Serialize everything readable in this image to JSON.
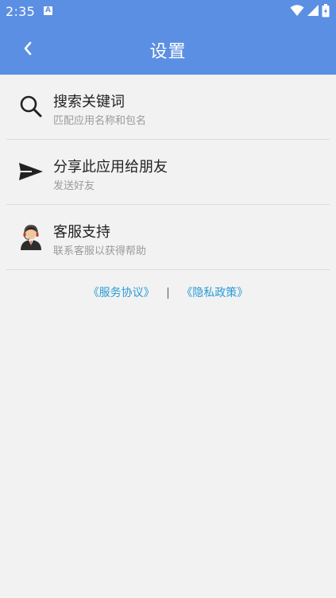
{
  "status_bar": {
    "time": "2:35",
    "notification_glyph": "A",
    "icons": [
      "wifi-icon",
      "signal-icon",
      "battery-icon"
    ]
  },
  "app_bar": {
    "title": "设置",
    "back_icon": "chevron-left-icon",
    "background_color": "#5b8fe3"
  },
  "menu": {
    "items": [
      {
        "icon": "search-icon",
        "title": "搜索关键词",
        "subtitle": "匹配应用名称和包名"
      },
      {
        "icon": "send-icon",
        "title": "分享此应用给朋友",
        "subtitle": "发送好友"
      },
      {
        "icon": "customer-service-avatar-icon",
        "title": "客服支持",
        "subtitle": "联系客服以获得帮助"
      }
    ]
  },
  "links": {
    "service_agreement": "《服务协议》",
    "separator": "|",
    "privacy_policy": "《隐私政策》",
    "link_color": "#2a9bd8"
  }
}
